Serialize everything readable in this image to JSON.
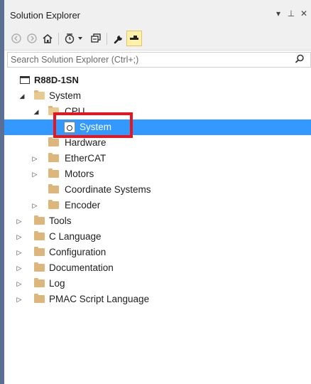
{
  "window": {
    "title": "Solution Explorer",
    "menu_glyph": "▾",
    "pin_glyph": "⊥",
    "close_glyph": "✕"
  },
  "search": {
    "placeholder": "Search Solution Explorer (Ctrl+;)"
  },
  "tree": {
    "root": "R88D-1SN",
    "items": [
      {
        "label": "System",
        "state": "expanded"
      },
      {
        "label": "CPU",
        "state": "expanded"
      },
      {
        "label": "System",
        "state": "selected"
      },
      {
        "label": "Hardware"
      },
      {
        "label": "EtherCAT",
        "state": "collapsed"
      },
      {
        "label": "Motors",
        "state": "collapsed"
      },
      {
        "label": "Coordinate Systems"
      },
      {
        "label": "Encoder",
        "state": "collapsed"
      },
      {
        "label": "Tools",
        "state": "collapsed"
      },
      {
        "label": "C Language",
        "state": "collapsed"
      },
      {
        "label": "Configuration",
        "state": "collapsed"
      },
      {
        "label": "Documentation",
        "state": "collapsed"
      },
      {
        "label": "Log",
        "state": "collapsed"
      },
      {
        "label": "PMAC Script Language",
        "state": "collapsed"
      }
    ]
  },
  "glyphs": {
    "expanded": "◢",
    "collapsed": "▷"
  },
  "colors": {
    "selection": "#3399ff",
    "callout": "#e8141e",
    "folder": "#dcb67a"
  }
}
